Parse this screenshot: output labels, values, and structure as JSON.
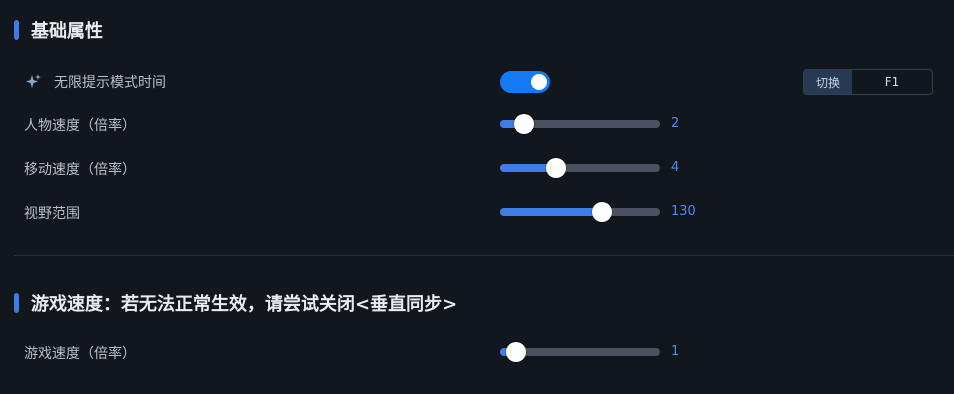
{
  "sections": [
    {
      "title": "基础属性",
      "rows": [
        {
          "label": "无限提示模式时间",
          "icon": "sparkle-icon",
          "control": "toggle",
          "on": true,
          "hotkey": {
            "label": "切换",
            "key": "F1"
          }
        },
        {
          "label": "人物速度（倍率）",
          "control": "slider",
          "value": "2",
          "level": 0.15
        },
        {
          "label": "移动速度（倍率）",
          "control": "slider",
          "value": "4",
          "level": 0.35
        },
        {
          "label": "视野范围",
          "control": "slider",
          "value": "130",
          "level": 0.64
        }
      ]
    },
    {
      "title": "游戏速度：若无法正常生效，请尝试关闭<垂直同步>",
      "rows": [
        {
          "label": "游戏速度（倍率）",
          "control": "slider",
          "value": "1",
          "level": 0.1
        }
      ]
    }
  ],
  "colors": {
    "accent": "#3e7ce8",
    "toggle_on": "#1479f5",
    "background": "#12161d",
    "value_text": "#4c8cf0"
  }
}
